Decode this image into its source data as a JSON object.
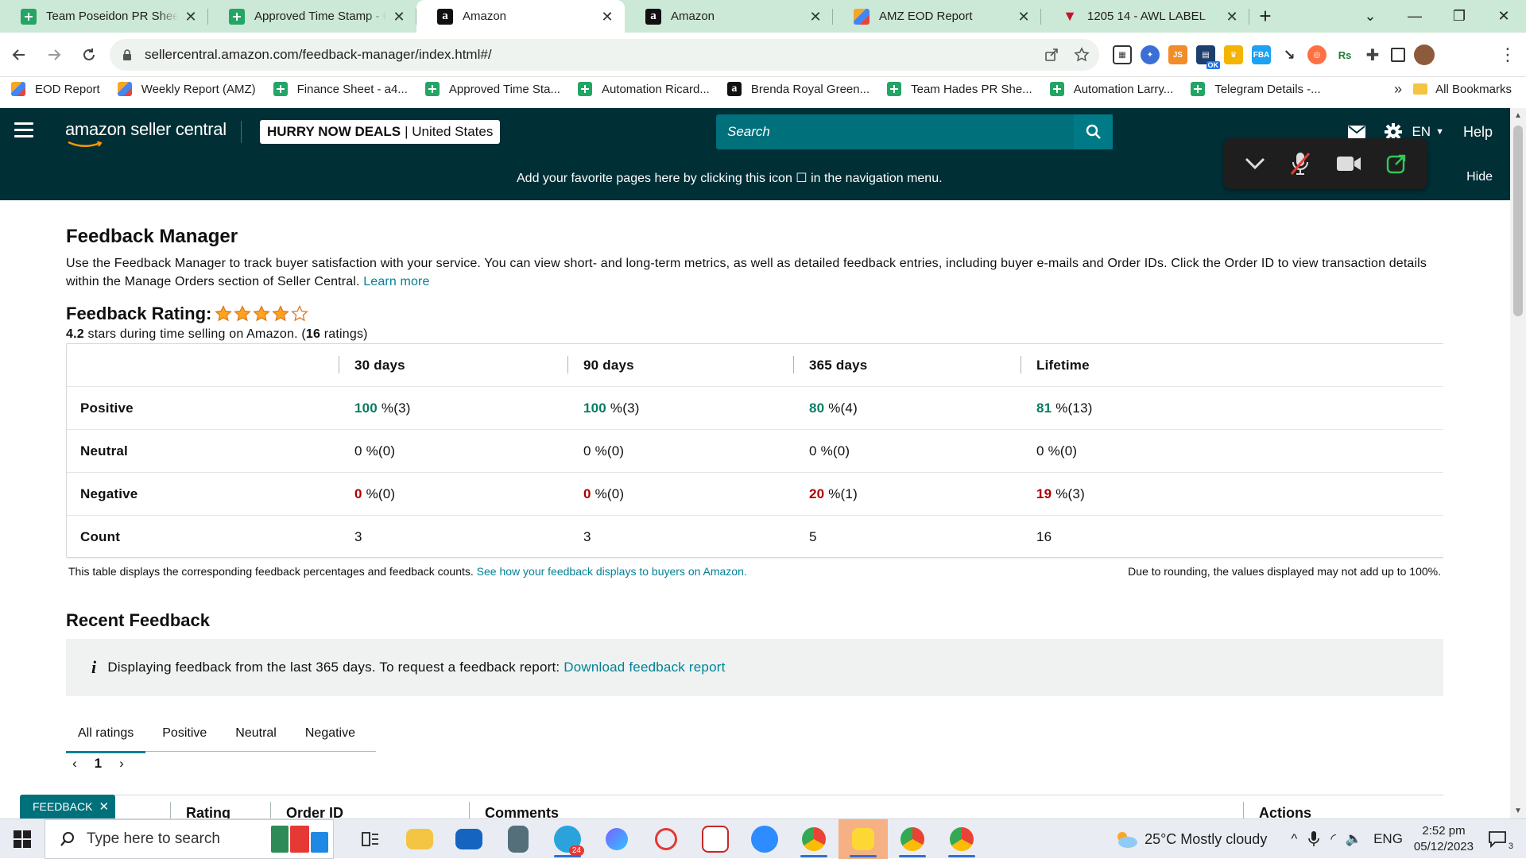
{
  "browser": {
    "tabs": [
      {
        "title": "Team Poseidon PR Sheet -",
        "favicon": "sheets-icon",
        "active": false
      },
      {
        "title": "Approved Time Stamp - G",
        "favicon": "sheets-icon",
        "active": false
      },
      {
        "title": "Amazon",
        "favicon": "amazon-icon",
        "active": true
      },
      {
        "title": "Amazon",
        "favicon": "amazon-icon",
        "active": false
      },
      {
        "title": "AMZ EOD Report",
        "favicon": "eod-icon",
        "active": false
      },
      {
        "title": "1205 14 - AWL LABEL",
        "favicon": "awl-icon",
        "active": false
      }
    ],
    "url": "sellercentral.amazon.com/feedback-manager/index.html#/",
    "bookmarks": [
      {
        "label": "EOD Report",
        "icon": "eod-icon"
      },
      {
        "label": "Weekly Report (AMZ)",
        "icon": "eod-icon"
      },
      {
        "label": "Finance Sheet - a4...",
        "icon": "sheets-icon"
      },
      {
        "label": "Approved Time Sta...",
        "icon": "sheets-icon"
      },
      {
        "label": "Automation Ricard...",
        "icon": "sheets-icon"
      },
      {
        "label": "Brenda Royal Green...",
        "icon": "amazon-icon"
      },
      {
        "label": "Team Hades PR She...",
        "icon": "sheets-icon"
      },
      {
        "label": "Automation Larry...",
        "icon": "sheets-icon"
      },
      {
        "label": "Telegram Details -...",
        "icon": "sheets-icon"
      }
    ],
    "bookmarks_more": "»",
    "all_bookmarks": "All Bookmarks"
  },
  "header": {
    "logo_text": "amazon seller central",
    "store_name": "HURRY NOW DEALS",
    "store_region": "| United States",
    "search_placeholder": "Search",
    "language": "EN",
    "help": "Help",
    "favorites_message": "Add your favorite pages here by clicking this icon ☐ in the navigation menu.",
    "hide": "Hide"
  },
  "page": {
    "title": "Feedback Manager",
    "intro": "Use the Feedback Manager to track buyer satisfaction with your service. You can view short- and long-term metrics, as well as detailed feedback entries, including buyer e-mails and Order IDs. Click the Order ID to view transaction details within the Manage Orders section of Seller Central.",
    "learn_more": "Learn more",
    "rating_label": "Feedback Rating:",
    "rating_value": "4.2",
    "rating_stars": 4,
    "rating_text": "stars during time selling on Amazon. (",
    "rating_count": "16",
    "rating_count_suffix": "ratings)"
  },
  "feedback_table": {
    "columns": [
      "30 days",
      "90 days",
      "365 days",
      "Lifetime"
    ],
    "rows": [
      {
        "label": "Positive",
        "kind": "pos",
        "cells": [
          {
            "pct": "100",
            "rest": " %(3)"
          },
          {
            "pct": "100",
            "rest": " %(3)"
          },
          {
            "pct": "80",
            "rest": " %(4)"
          },
          {
            "pct": "81",
            "rest": " %(13)"
          }
        ]
      },
      {
        "label": "Neutral",
        "kind": "neu",
        "cells": [
          {
            "pct": "0",
            "rest": " %(0)"
          },
          {
            "pct": "0",
            "rest": " %(0)"
          },
          {
            "pct": "0",
            "rest": " %(0)"
          },
          {
            "pct": "0",
            "rest": " %(0)"
          }
        ]
      },
      {
        "label": "Negative",
        "kind": "neg",
        "cells": [
          {
            "pct": "0",
            "rest": " %(0)"
          },
          {
            "pct": "0",
            "rest": " %(0)"
          },
          {
            "pct": "20",
            "rest": " %(1)"
          },
          {
            "pct": "19",
            "rest": " %(3)"
          }
        ]
      },
      {
        "label": "Count",
        "kind": "count",
        "cells": [
          {
            "pct": "3",
            "rest": ""
          },
          {
            "pct": "3",
            "rest": ""
          },
          {
            "pct": "5",
            "rest": ""
          },
          {
            "pct": "16",
            "rest": ""
          }
        ]
      }
    ],
    "note_left": "This table displays the corresponding feedback percentages and feedback counts.",
    "note_left_link": "See how your feedback displays to buyers on Amazon.",
    "note_right": "Due to rounding, the values displayed may not add up to 100%."
  },
  "recent": {
    "title": "Recent Feedback",
    "info": "Displaying feedback from the last 365 days. To request a feedback report:",
    "info_link": "Download feedback report",
    "tabs": [
      "All ratings",
      "Positive",
      "Neutral",
      "Negative"
    ],
    "active_tab": 0,
    "page": "1",
    "columns": [
      "Rating",
      "Order ID",
      "Comments",
      "Actions"
    ]
  },
  "feedback_button": "FEEDBACK",
  "taskbar": {
    "search_placeholder": "Type here to search",
    "weather": "25°C  Mostly cloudy",
    "language": "ENG",
    "time": "2:52 pm",
    "date": "05/12/2023",
    "notification_count": "3",
    "telegram_badge": "24"
  },
  "colors": {
    "header_bg": "#002f36",
    "search_bg": "#00707b",
    "link": "#008296",
    "positive": "#067d62",
    "negative": "#ad0000",
    "tabstrip_bg": "#cce8d6"
  }
}
